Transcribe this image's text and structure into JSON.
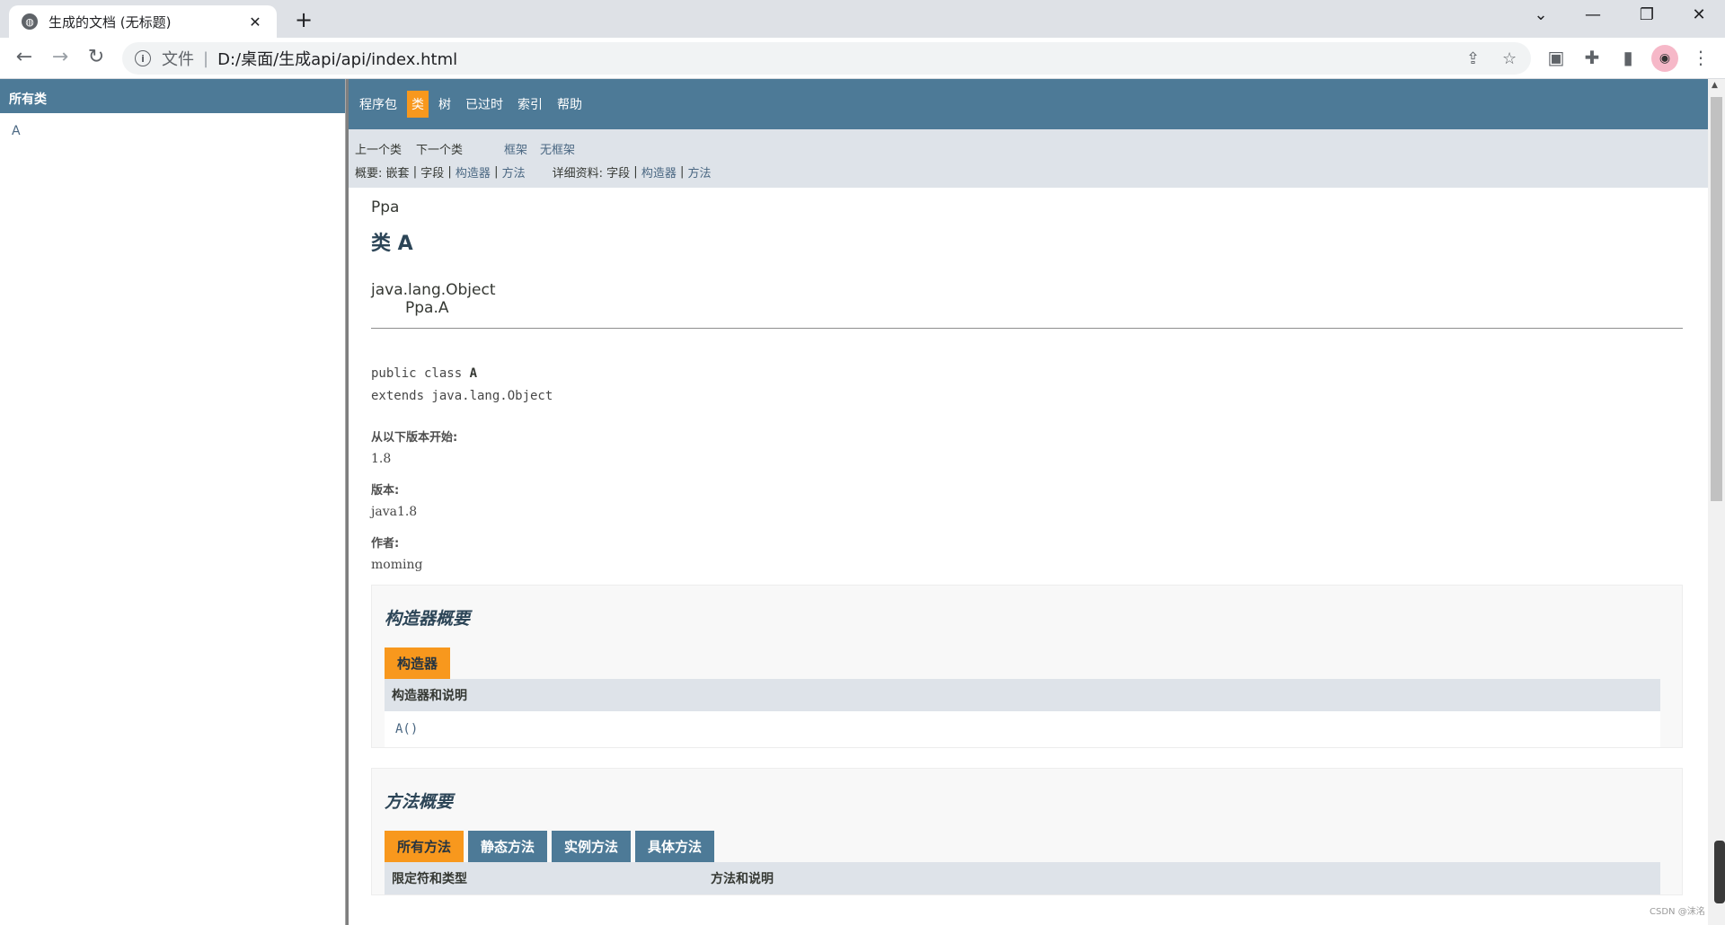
{
  "browser": {
    "tab_title": "生成的文档 (无标题)",
    "tab_close": "✕",
    "new_tab": "+",
    "scheme_label": "文件",
    "separator": "|",
    "url": "D:/桌面/生成api/api/index.html",
    "icons": [
      "back-arrow-icon",
      "forward-arrow-icon",
      "reload-icon",
      "info-icon",
      "share-icon",
      "star-icon",
      "extension-icon",
      "puzzle-icon",
      "sidebar-icon",
      "menu-icon"
    ]
  },
  "left": {
    "header": "所有类",
    "items": [
      "A"
    ]
  },
  "nav": {
    "items": [
      "程序包",
      "类",
      "树",
      "已过时",
      "索引",
      "帮助"
    ],
    "active_index": 1,
    "prev_class": "上一个类",
    "next_class": "下一个类",
    "frames": "框架",
    "no_frames": "无框架",
    "summary_prefix": "概要:",
    "summary_nested": "嵌套",
    "summary_field": "字段",
    "summary_constructor": "构造器",
    "summary_method": "方法",
    "detail_prefix": "详细资料:",
    "detail_field": "字段",
    "detail_constructor": "构造器",
    "detail_method": "方法",
    "pipe": "|"
  },
  "doc": {
    "package": "Ppa",
    "title": "类 A",
    "inherit_parent": "java.lang.Object",
    "inherit_child": "Ppa.A",
    "sig_public": "public class ",
    "sig_name": "A",
    "sig_extends": "extends java.lang.Object",
    "since_label": "从以下版本开始:",
    "since_value": "1.8",
    "version_label": "版本:",
    "version_value": "java1.8",
    "author_label": "作者:",
    "author_value": "moming"
  },
  "constructor_summary": {
    "heading": "构造器概要",
    "caption": "构造器",
    "column": "构造器和说明",
    "rows": [
      "A()"
    ]
  },
  "method_summary": {
    "heading": "方法概要",
    "tabs": [
      "所有方法",
      "静态方法",
      "实例方法",
      "具体方法"
    ],
    "col1": "限定符和类型",
    "col2": "方法和说明"
  },
  "watermark": "CSDN @沫洺",
  "colors": {
    "nav_blue": "#4d7a97",
    "accent_orange": "#f8981d",
    "subnav_gray": "#dee3e9"
  }
}
